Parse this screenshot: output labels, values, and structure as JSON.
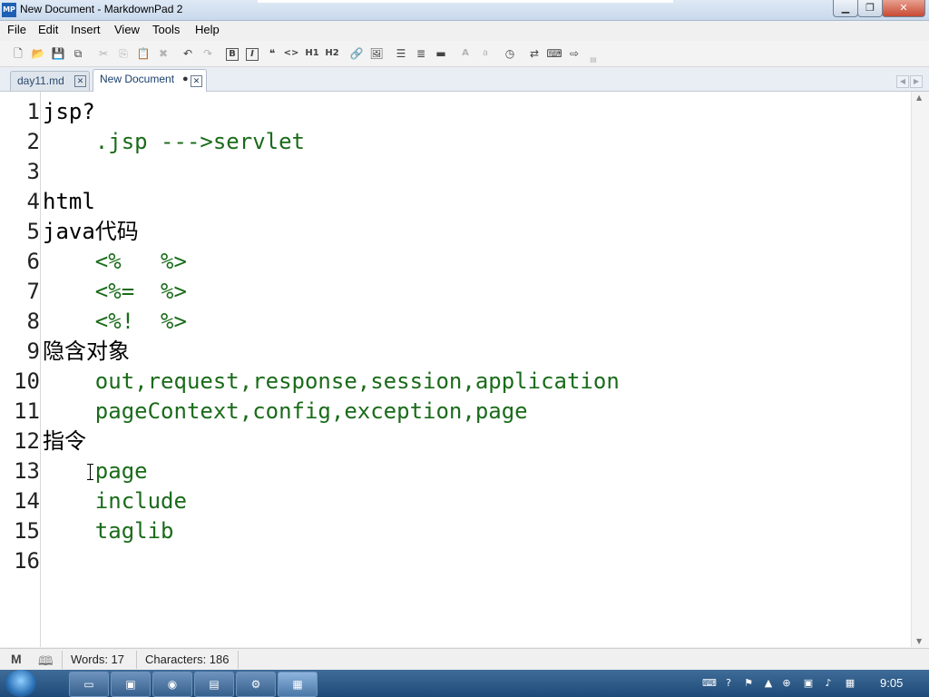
{
  "window": {
    "title": "New Document - MarkdownPad 2",
    "app_icon_text": "MP",
    "minimize_glyph": "▁",
    "maximize_glyph": "❐",
    "close_glyph": "✕"
  },
  "menu": [
    "File",
    "Edit",
    "Insert",
    "View",
    "Tools",
    "Help"
  ],
  "toolbar": {
    "bold": "B",
    "italic": "I",
    "quote": "❝",
    "code": "<>",
    "h1": "H1",
    "h2": "H2",
    "font_large": "A",
    "font_small": "a",
    "icons": [
      "new-document-icon",
      "open-folder-icon",
      "save-icon",
      "save-all-icon",
      "cut-icon",
      "copy-icon",
      "paste-icon",
      "delete-icon",
      "undo-icon",
      "redo-icon",
      "bold-icon",
      "italic-icon",
      "quote-icon",
      "code-icon",
      "h1-icon",
      "h2-icon",
      "link-icon",
      "image-icon",
      "bullet-list-icon",
      "numbered-list-icon",
      "horizontal-rule-icon",
      "increase-font-icon",
      "decrease-font-icon",
      "timestamp-icon",
      "swap-icon",
      "preview-icon",
      "export-icon"
    ]
  },
  "tabs": [
    {
      "label": "day11.md",
      "close": "✕"
    },
    {
      "label": "New Document",
      "modified": "●",
      "close": "✕"
    }
  ],
  "editor": {
    "lines": [
      {
        "n": "1",
        "text": "jsp?",
        "green": false
      },
      {
        "n": "2",
        "text": "    .jsp --->servlet",
        "green": true
      },
      {
        "n": "3",
        "text": "",
        "green": false
      },
      {
        "n": "4",
        "text": "html",
        "green": false
      },
      {
        "n": "5",
        "text": "java代码",
        "green": false
      },
      {
        "n": "6",
        "text": "    <%   %>",
        "green": true
      },
      {
        "n": "7",
        "text": "    <%=  %>",
        "green": true
      },
      {
        "n": "8",
        "text": "    <%!  %>",
        "green": true
      },
      {
        "n": "9",
        "text": "隐含对象",
        "green": false
      },
      {
        "n": "10",
        "text": "    out,request,response,session,application",
        "green": true
      },
      {
        "n": "11",
        "text": "    pageContext,config,exception,page",
        "green": true
      },
      {
        "n": "12",
        "text": "指令",
        "green": false
      },
      {
        "n": "13",
        "text": "    page",
        "green": true
      },
      {
        "n": "14",
        "text": "    include",
        "green": true
      },
      {
        "n": "15",
        "text": "    taglib",
        "green": true
      },
      {
        "n": "16",
        "text": "",
        "green": false
      }
    ]
  },
  "status": {
    "md_icon": "M",
    "preview_icon": "🕮",
    "words": "Words: 17",
    "characters": "Characters: 186"
  },
  "taskbar": {
    "clock": "9:05"
  }
}
